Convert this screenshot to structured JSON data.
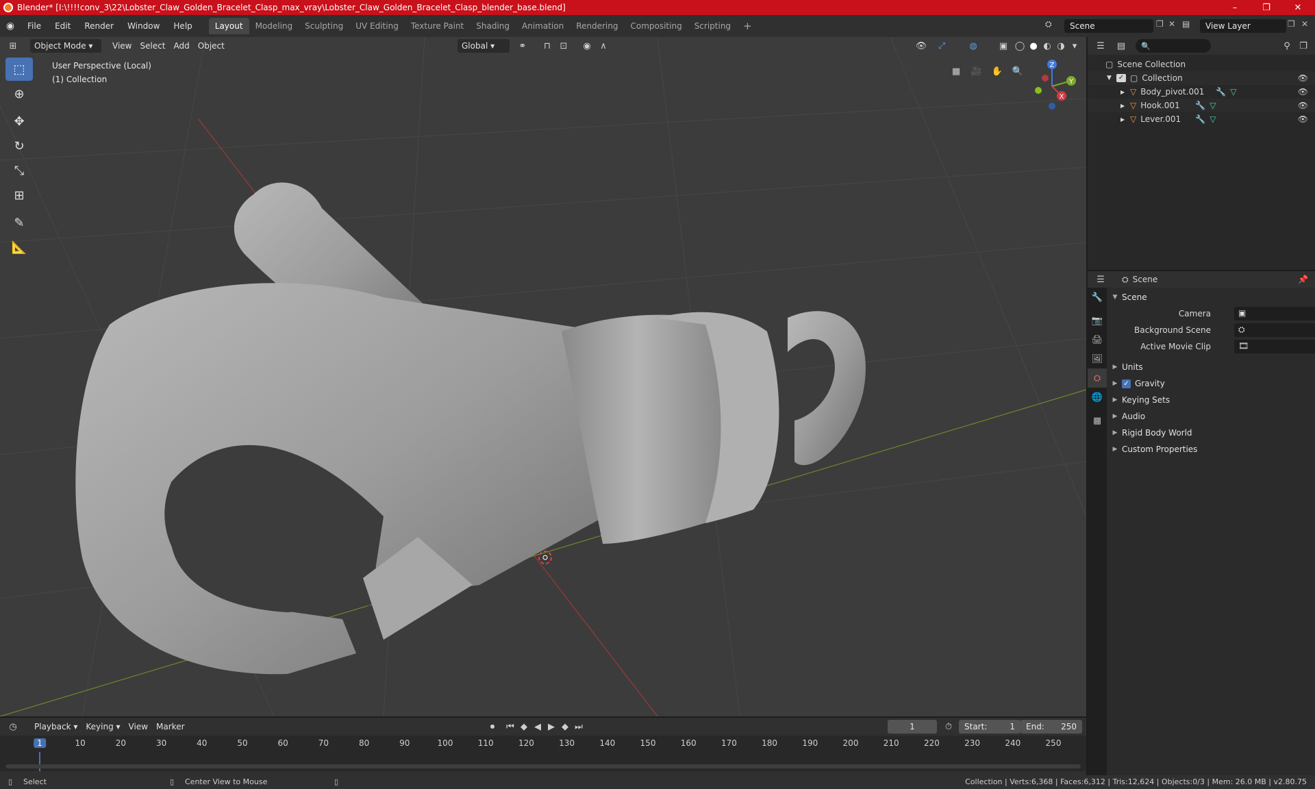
{
  "title_bar": {
    "title": "Blender* [I:\\!!!!conv_3\\22\\Lobster_Claw_Golden_Bracelet_Clasp_max_vray\\Lobster_Claw_Golden_Bracelet_Clasp_blender_base.blend]",
    "minimize": "–",
    "maximize": "❐",
    "close": "✕"
  },
  "menu": [
    "File",
    "Edit",
    "Render",
    "Window",
    "Help"
  ],
  "workspaces": [
    "Layout",
    "Modeling",
    "Sculpting",
    "UV Editing",
    "Texture Paint",
    "Shading",
    "Animation",
    "Rendering",
    "Compositing",
    "Scripting"
  ],
  "active_workspace": "Layout",
  "scene_field": "Scene",
  "view_layer_field": "View Layer",
  "viewport": {
    "mode": "Object Mode",
    "menus": [
      "View",
      "Select",
      "Add",
      "Object"
    ],
    "transform_orientation": "Global",
    "info_line1": "User Perspective (Local)",
    "info_line2": "(1) Collection",
    "gizmo_axes": {
      "x": "X",
      "y": "Y",
      "z": "Z"
    },
    "accent": "#4772b3"
  },
  "outliner": {
    "search_placeholder": "",
    "scene_collection": "Scene Collection",
    "collection": "Collection",
    "objects": [
      "Body_pivot.001",
      "Hook.001",
      "Lever.001"
    ]
  },
  "properties": {
    "context": "Scene",
    "panel_scene": "Scene",
    "camera_label": "Camera",
    "background_scene_label": "Background Scene",
    "active_movie_clip_label": "Active Movie Clip",
    "panels": [
      "Units",
      "Gravity",
      "Keying Sets",
      "Audio",
      "Rigid Body World",
      "Custom Properties"
    ],
    "gravity_checked": true
  },
  "timeline": {
    "menus": [
      "Playback",
      "Keying",
      "View",
      "Marker"
    ],
    "current_frame": "1",
    "start_label": "Start:",
    "start_value": "1",
    "end_label": "End:",
    "end_value": "250",
    "ruler_ticks": [
      "1",
      "10",
      "20",
      "30",
      "40",
      "50",
      "60",
      "70",
      "80",
      "90",
      "100",
      "110",
      "120",
      "130",
      "140",
      "150",
      "160",
      "170",
      "180",
      "190",
      "200",
      "210",
      "220",
      "230",
      "240",
      "250"
    ]
  },
  "status_bar": {
    "left_action": "Select",
    "middle_action": "Center View to Mouse",
    "stats": "Collection | Verts:6,368 | Faces:6,312 | Tris:12,624 | Objects:0/3 | Mem: 26.0 MB | v2.80.75"
  }
}
